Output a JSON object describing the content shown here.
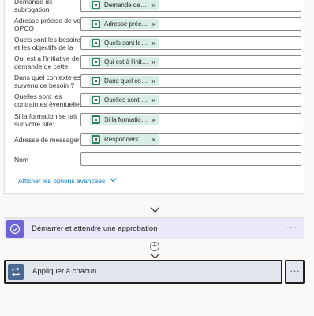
{
  "form": {
    "rows": [
      {
        "label": "Demande de\nsubrogation",
        "token": "Demande de s..."
      },
      {
        "label": "Adresse précise de votre\nOPCO",
        "token": "Adresse précis..."
      },
      {
        "label": "Quels sont les besoins\net les objectifs de la",
        "token": "Quels sont les ..."
      },
      {
        "label": "Qui est à l'initiative de la\ndemande de cette",
        "token": "Qui est à l'initi..."
      },
      {
        "label": "Dans quel contexte est\nsurvenu ce besoin ?",
        "token": "Dans quel cont..."
      },
      {
        "label": "Quelles sont les\ncontraintes éventuelles",
        "token": "Quelles sont le..."
      },
      {
        "label": "Si la formation se fait\nsur votre site:",
        "token": "Si la formation ..."
      },
      {
        "label": "Adresse de messagerie",
        "token": "Responders' E..."
      }
    ],
    "name_label": "Nom",
    "name_value": "",
    "token_close": "×",
    "advanced_label": "Afficher les options avancées"
  },
  "approval_step": {
    "title": "Démarrer et attendre une approbation",
    "more": "···",
    "color": "#6b63d6"
  },
  "foreach_step": {
    "title": "Appliquer à chacun",
    "more": "···",
    "color": "#486991"
  },
  "icons": {
    "token": "forms-icon",
    "approval": "approval-icon",
    "foreach": "loop-icon",
    "chevron": "chevron-down-icon",
    "add": "plus-icon",
    "arrow": "arrow-down-icon"
  }
}
